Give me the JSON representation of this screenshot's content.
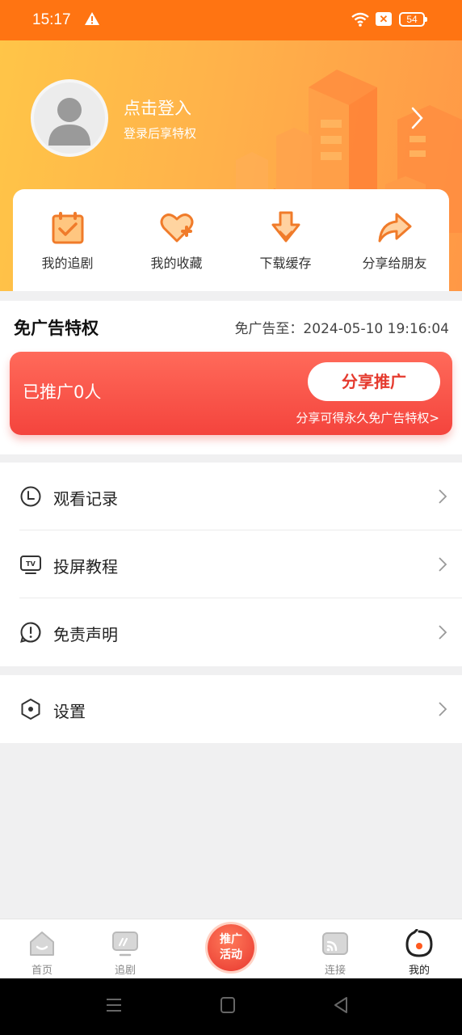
{
  "status_bar": {
    "time": "15:17",
    "battery": "54"
  },
  "header": {
    "login_title": "点击登入",
    "login_subtitle": "登录后享特权"
  },
  "quick_actions": [
    {
      "label": "我的追剧",
      "icon": "calendar-check-icon"
    },
    {
      "label": "我的收藏",
      "icon": "heart-plus-icon"
    },
    {
      "label": "下载缓存",
      "icon": "download-icon"
    },
    {
      "label": "分享给朋友",
      "icon": "share-arrow-icon"
    }
  ],
  "privilege": {
    "title": "免广告特权",
    "expire": "免广告至：2024-05-10 19:16:04",
    "promoted_count": "已推广0人",
    "share_button": "分享推广",
    "share_hint": "分享可得永久免广告特权>"
  },
  "menu": [
    {
      "label": "观看记录",
      "icon": "clock-icon"
    },
    {
      "label": "投屏教程",
      "icon": "tv-icon"
    },
    {
      "label": "免责声明",
      "icon": "alert-circle-icon"
    }
  ],
  "settings": {
    "label": "设置",
    "icon": "hexagon-gear-icon"
  },
  "bottom_nav": {
    "home": "首页",
    "follow": "追剧",
    "promo_line1": "推广",
    "promo_line2": "活动",
    "connect": "连接",
    "mine": "我的"
  },
  "colors": {
    "brand_orange": "#ff7412",
    "promo_red": "#f4443d",
    "header_yellow": "#ffc548"
  }
}
